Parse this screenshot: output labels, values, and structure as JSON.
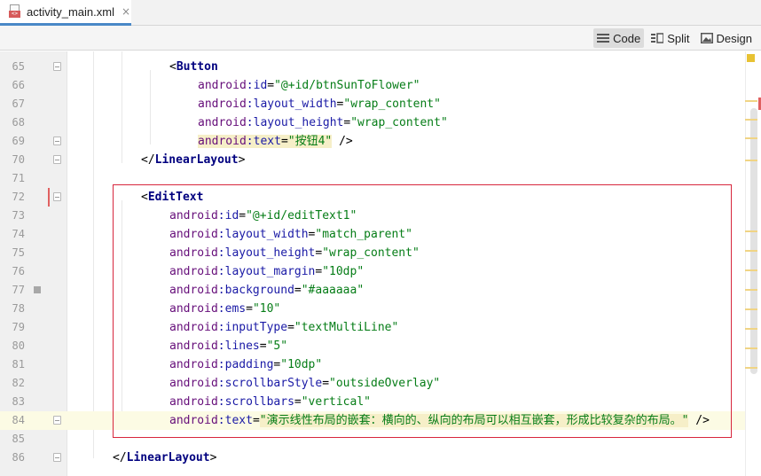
{
  "tab": {
    "title": "activity_main.xml",
    "close": "×"
  },
  "toolbar": {
    "modes": [
      {
        "label": "Code",
        "icon": "code-lines-icon",
        "active": true
      },
      {
        "label": "Split",
        "icon": "split-view-icon",
        "active": false
      },
      {
        "label": "Design",
        "icon": "image-icon",
        "active": false
      }
    ]
  },
  "editor": {
    "lines": [
      {
        "num": "65",
        "indent": 12,
        "tokens": [
          [
            "punct",
            "<"
          ],
          [
            "tag",
            "Button"
          ]
        ],
        "fold": true
      },
      {
        "num": "66",
        "indent": 16,
        "tokens": [
          [
            "attr-ns",
            "android"
          ],
          [
            "attr",
            ":id"
          ],
          [
            "punct",
            "="
          ],
          [
            "val",
            "\"@+id/btnSunToFlower\""
          ]
        ]
      },
      {
        "num": "67",
        "indent": 16,
        "tokens": [
          [
            "attr-ns",
            "android"
          ],
          [
            "attr",
            ":layout_width"
          ],
          [
            "punct",
            "="
          ],
          [
            "val",
            "\"wrap_content\""
          ]
        ]
      },
      {
        "num": "68",
        "indent": 16,
        "tokens": [
          [
            "attr-ns",
            "android"
          ],
          [
            "attr",
            ":layout_height"
          ],
          [
            "punct",
            "="
          ],
          [
            "val",
            "\"wrap_content\""
          ]
        ]
      },
      {
        "num": "69",
        "indent": 16,
        "tokens": [
          [
            "attr-ns hl-attr",
            "android"
          ],
          [
            "attr hl-attr",
            ":text"
          ],
          [
            "punct hl-attr",
            "="
          ],
          [
            "val hl-attr",
            "\"按钮4\""
          ],
          [
            "punct",
            " />"
          ]
        ],
        "fold": true
      },
      {
        "num": "70",
        "indent": 8,
        "tokens": [
          [
            "punct",
            "</"
          ],
          [
            "tag",
            "LinearLayout"
          ],
          [
            "punct",
            ">"
          ]
        ],
        "fold": true
      },
      {
        "num": "71",
        "indent": 0,
        "tokens": []
      },
      {
        "num": "72",
        "indent": 8,
        "tokens": [
          [
            "punct",
            "<"
          ],
          [
            "tag",
            "EditText"
          ]
        ],
        "fold": true,
        "redmark": true
      },
      {
        "num": "73",
        "indent": 12,
        "tokens": [
          [
            "attr-ns",
            "android"
          ],
          [
            "attr",
            ":id"
          ],
          [
            "punct",
            "="
          ],
          [
            "val",
            "\"@+id/editText1\""
          ]
        ]
      },
      {
        "num": "74",
        "indent": 12,
        "tokens": [
          [
            "attr-ns",
            "android"
          ],
          [
            "attr",
            ":layout_width"
          ],
          [
            "punct",
            "="
          ],
          [
            "val",
            "\"match_parent\""
          ]
        ]
      },
      {
        "num": "75",
        "indent": 12,
        "tokens": [
          [
            "attr-ns",
            "android"
          ],
          [
            "attr",
            ":layout_height"
          ],
          [
            "punct",
            "="
          ],
          [
            "val",
            "\"wrap_content\""
          ]
        ]
      },
      {
        "num": "76",
        "indent": 12,
        "tokens": [
          [
            "attr-ns",
            "android"
          ],
          [
            "attr",
            ":layout_margin"
          ],
          [
            "punct",
            "="
          ],
          [
            "val",
            "\"10dp\""
          ]
        ]
      },
      {
        "num": "77",
        "indent": 12,
        "tokens": [
          [
            "attr-ns",
            "android"
          ],
          [
            "attr",
            ":background"
          ],
          [
            "punct",
            "="
          ],
          [
            "val",
            "\"#aaaaaa\""
          ]
        ],
        "bookmark": true
      },
      {
        "num": "78",
        "indent": 12,
        "tokens": [
          [
            "attr-ns",
            "android"
          ],
          [
            "attr",
            ":ems"
          ],
          [
            "punct",
            "="
          ],
          [
            "val",
            "\"10\""
          ]
        ]
      },
      {
        "num": "79",
        "indent": 12,
        "tokens": [
          [
            "attr-ns",
            "android"
          ],
          [
            "attr",
            ":inputType"
          ],
          [
            "punct",
            "="
          ],
          [
            "val",
            "\"textMultiLine\""
          ]
        ]
      },
      {
        "num": "80",
        "indent": 12,
        "tokens": [
          [
            "attr-ns",
            "android"
          ],
          [
            "attr",
            ":lines"
          ],
          [
            "punct",
            "="
          ],
          [
            "val",
            "\"5\""
          ]
        ]
      },
      {
        "num": "81",
        "indent": 12,
        "tokens": [
          [
            "attr-ns",
            "android"
          ],
          [
            "attr",
            ":padding"
          ],
          [
            "punct",
            "="
          ],
          [
            "val",
            "\"10dp\""
          ]
        ]
      },
      {
        "num": "82",
        "indent": 12,
        "tokens": [
          [
            "attr-ns",
            "android"
          ],
          [
            "attr",
            ":scrollbarStyle"
          ],
          [
            "punct",
            "="
          ],
          [
            "val",
            "\"outsideOverlay\""
          ]
        ]
      },
      {
        "num": "83",
        "indent": 12,
        "tokens": [
          [
            "attr-ns",
            "android"
          ],
          [
            "attr",
            ":scrollbars"
          ],
          [
            "punct",
            "="
          ],
          [
            "val",
            "\"vertical\""
          ]
        ]
      },
      {
        "num": "84",
        "indent": 12,
        "tokens": [
          [
            "attr-ns",
            "android"
          ],
          [
            "attr",
            ":text"
          ],
          [
            "punct",
            "="
          ],
          [
            "val hl-attr",
            "\"演示线性布局的嵌套：横向的、纵向的布局可以相互嵌套，形成比较复杂的布局。\""
          ],
          [
            "punct",
            " />"
          ]
        ],
        "fold": true,
        "caret": true
      },
      {
        "num": "85",
        "indent": 0,
        "tokens": []
      },
      {
        "num": "86",
        "indent": 4,
        "tokens": [
          [
            "punct",
            "</"
          ],
          [
            "tag",
            "LinearLayout"
          ],
          [
            "punct",
            ">"
          ]
        ],
        "fold": true
      }
    ]
  }
}
